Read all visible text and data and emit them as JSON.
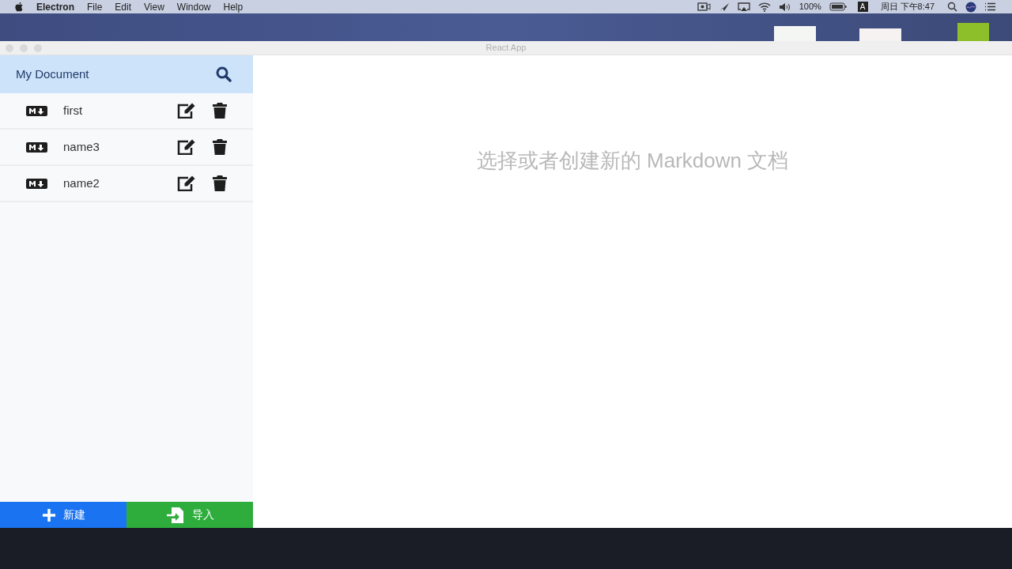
{
  "menu_bar": {
    "app_name": "Electron",
    "menus": [
      "File",
      "Edit",
      "View",
      "Window",
      "Help"
    ],
    "battery_percent": "100%",
    "input_method": "A",
    "clock": "周日 下午8:47"
  },
  "window": {
    "title": "React App"
  },
  "sidebar": {
    "title": "My Document",
    "files": [
      {
        "name": "first"
      },
      {
        "name": "name3"
      },
      {
        "name": "name2"
      }
    ],
    "buttons": [
      {
        "kind": "new",
        "label": "新建"
      },
      {
        "kind": "import",
        "label": "导入"
      }
    ]
  },
  "main": {
    "placeholder_message": "选择或者创建新的 Markdown 文档"
  }
}
